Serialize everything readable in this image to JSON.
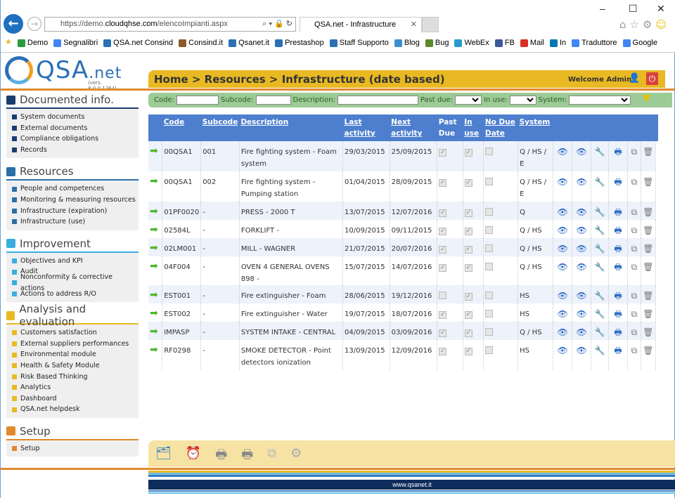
{
  "browser": {
    "url_prefix": "https://demo.",
    "url_domain": "cloudqhse.com",
    "url_path": "/elencoImpianti.aspx",
    "tab_title": "QSA.net - Infrastructure",
    "bookmarks": [
      "Demo",
      "Segnalibri",
      "QSA.net Consind",
      "Consind.it",
      "Qsanet.it",
      "Prestashop",
      "Staff Supporto",
      "Blog",
      "Bug",
      "WebEx",
      "FB",
      "Mail",
      "In",
      "Traduttore",
      "Google"
    ]
  },
  "logo": {
    "text": "QSA",
    "suffix": ".net",
    "version": "(vers. 8.0.0.1264)"
  },
  "header": {
    "breadcrumb": "Home > Resources > Infrastructure (date based)",
    "welcome": "Welcome Admin"
  },
  "filters": {
    "code": "Code:",
    "subcode": "Subcode:",
    "description": "Description:",
    "past_due": "Past due:",
    "in_use": "In use:",
    "system": "System:"
  },
  "sidebar": [
    {
      "title": "Documented info.",
      "color": "#1a3d6e",
      "items": [
        "System documents",
        "External documents",
        "Compliance obligations",
        "Records"
      ]
    },
    {
      "title": "Resources",
      "color": "#2a6fa8",
      "items": [
        "People and competences",
        "Monitoring & measuring resources",
        "Infrastructure (expiration)",
        "Infrastructure (use)"
      ]
    },
    {
      "title": "Improvement",
      "color": "#3aaee0",
      "items": [
        "Objectives and KPI",
        "Audit",
        "Nonconformity & corrective actions",
        "Actions to address R/O"
      ]
    },
    {
      "title": "Analysis and evaluation",
      "color": "#e8b923",
      "items": [
        "Customers satisfaction",
        "External suppliers performances",
        "Environmental module",
        "Health & Safety Module",
        "Risk Based Thinking",
        "Analytics",
        "Dashboard",
        "QSA.net helpdesk"
      ]
    },
    {
      "title": "Setup",
      "color": "#e08a2e",
      "items": [
        "Setup"
      ]
    }
  ],
  "table": {
    "headers": [
      "Code",
      "Subcode",
      "Description",
      "Last activity",
      "Next activity",
      "Past Due",
      "In use",
      "No Due Date",
      "System"
    ],
    "rows": [
      {
        "code": "00QSA1",
        "subcode": "001",
        "description": "Fire fighting system - Foam system",
        "last": "29/03/2015",
        "next": "25/09/2015",
        "past_due": true,
        "in_use": true,
        "no_due": false,
        "system": "Q / HS / E"
      },
      {
        "code": "00QSA1",
        "subcode": "002",
        "description": "Fire fighting system - Pumping station",
        "last": "01/04/2015",
        "next": "28/09/2015",
        "past_due": true,
        "in_use": true,
        "no_due": false,
        "system": "Q / HS / E"
      },
      {
        "code": "01PF0020",
        "subcode": "-",
        "description": "PRESS - 2000 T",
        "last": "13/07/2015",
        "next": "12/07/2016",
        "past_due": true,
        "in_use": true,
        "no_due": false,
        "system": "Q"
      },
      {
        "code": "02584L",
        "subcode": "-",
        "description": "FORKLIFT -",
        "last": "10/09/2015",
        "next": "09/11/2015",
        "past_due": true,
        "in_use": true,
        "no_due": false,
        "system": "Q / HS"
      },
      {
        "code": "02LM001",
        "subcode": "-",
        "description": "MILL - WAGNER",
        "last": "21/07/2015",
        "next": "20/07/2016",
        "past_due": true,
        "in_use": true,
        "no_due": false,
        "system": "Q / HS"
      },
      {
        "code": "04F004",
        "subcode": "-",
        "description": "OVEN 4 GENERAL OVENS 898 -",
        "last": "15/07/2015",
        "next": "14/07/2016",
        "past_due": true,
        "in_use": true,
        "no_due": false,
        "system": "Q / HS"
      },
      {
        "code": "EST001",
        "subcode": "-",
        "description": "Fire extinguisher - Foam",
        "last": "28/06/2015",
        "next": "19/12/2016",
        "past_due": false,
        "in_use": true,
        "no_due": false,
        "system": "HS"
      },
      {
        "code": "EST002",
        "subcode": "-",
        "description": "Fire extinguisher - Water",
        "last": "19/07/2015",
        "next": "18/07/2016",
        "past_due": true,
        "in_use": true,
        "no_due": false,
        "system": "HS"
      },
      {
        "code": "IMPASP",
        "subcode": "-",
        "description": "SYSTEM INTAKE - CENTRAL",
        "last": "04/09/2015",
        "next": "03/09/2016",
        "past_due": true,
        "in_use": true,
        "no_due": false,
        "system": "Q / HS"
      },
      {
        "code": "RF0298",
        "subcode": "-",
        "description": "SMOKE DETECTOR - Point detectors ionization",
        "last": "13/09/2015",
        "next": "12/09/2016",
        "past_due": true,
        "in_use": true,
        "no_due": false,
        "system": "HS"
      }
    ]
  },
  "bottom_toolbar": [
    "add-folder-icon",
    "alarm-clock-icon",
    "printer-icon",
    "printer-icon",
    "copy-icon",
    "settings-warning-icon"
  ],
  "footer": "www.qsanet.it"
}
